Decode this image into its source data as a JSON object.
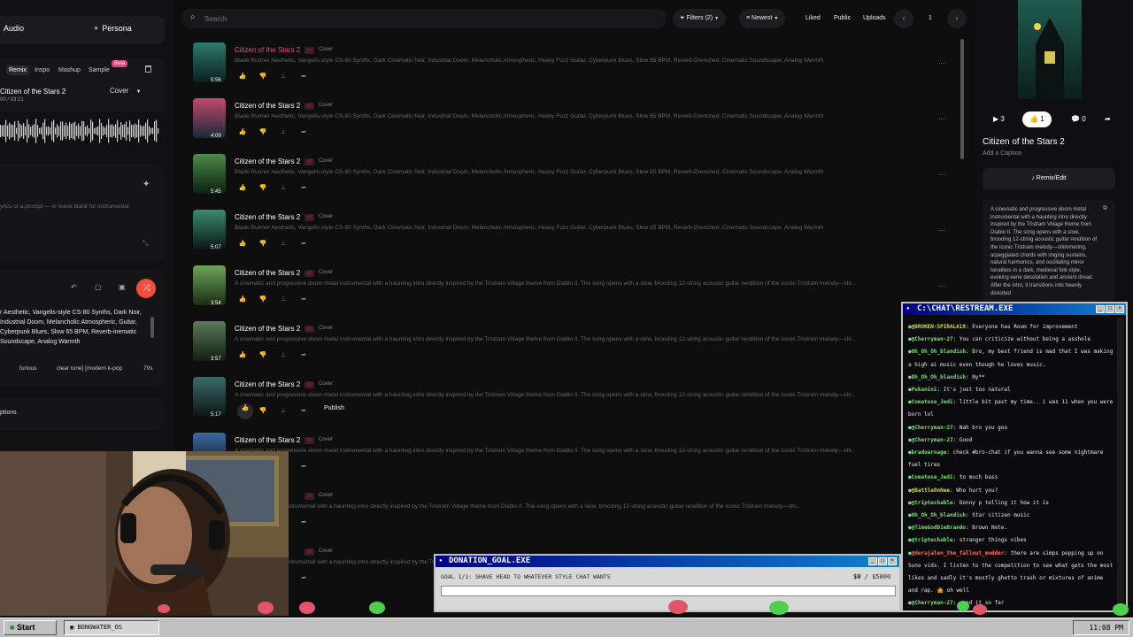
{
  "left": {
    "tab_audio": "Audio",
    "tab_persona": "Persona",
    "modes": [
      "Remix",
      "Inspo",
      "Mashup",
      "Sample"
    ],
    "beta": "Beta",
    "song_title": "Citizen of the Stars 2",
    "song_time": "00 / 03:21",
    "cover_label": "Cover",
    "lyrics_placeholder": "yrics or a prompt — or leave blank for instrumental",
    "style_text": "r Aesthetic, Vangelis-style CS-80 Synths, Dark Noir, Industrial Doom, Melancholic Atmospheric, Guitar, Cyberpunk Blues, Slow 65 BPM, Reverb-inematic Soundscape, Analog Warmth",
    "tags": [
      "furious",
      "clear tone] [modern k-pop",
      "70s"
    ],
    "options_label": "ptions"
  },
  "topbar": {
    "search_placeholder": "Search",
    "filters": "Filters (2)",
    "sort": "Newest",
    "liked": "Liked",
    "public": "Public",
    "uploads": "Uploads",
    "page": "1"
  },
  "songs": [
    {
      "title": "Citizen of the Stars 2",
      "duration": "5:56",
      "cover": "Cover",
      "desc": "Blade Runner Aesthetic, Vangelis-style CS-80 Synths, Dark Cinematic Noir, Industrial Doom, Melancholic Atmospheric, Heavy Fuzz Guitar, Cyberpunk Blues, Slow 65 BPM, Reverb-Drenched, Cinematic Soundscape, Analog Warmth"
    },
    {
      "title": "Citizen of the Stars 2",
      "duration": "4:09",
      "cover": "Cover",
      "desc": "Blade Runner Aesthetic, Vangelis-style CS-80 Synths, Dark Cinematic Noir, Industrial Doom, Melancholic Atmospheric, Heavy Fuzz Guitar, Cyberpunk Blues, Slow 65 BPM, Reverb-Drenched, Cinematic Soundscape, Analog Warmth"
    },
    {
      "title": "Citizen of the Stars 2",
      "duration": "5:45",
      "cover": "Cover",
      "desc": "Blade Runner Aesthetic, Vangelis-style CS-80 Synths, Dark Cinematic Noir, Industrial Doom, Melancholic Atmospheric, Heavy Fuzz Guitar, Cyberpunk Blues, Slow 65 BPM, Reverb-Drenched, Cinematic Soundscape, Analog Warmth"
    },
    {
      "title": "Citizen of the Stars 2",
      "duration": "5:07",
      "cover": "Cover",
      "desc": "Blade Runner Aesthetic, Vangelis-style CS-80 Synths, Dark Cinematic Noir, Industrial Doom, Melancholic Atmospheric, Heavy Fuzz Guitar, Cyberpunk Blues, Slow 65 BPM, Reverb-Drenched, Cinematic Soundscape, Analog Warmth"
    },
    {
      "title": "Citizen of the Stars 2",
      "duration": "3:54",
      "cover": "Cover",
      "desc": "A cinematic and progressive doom metal instrumental with a haunting intro directly inspired by the Tristram Village theme from Diablo II. The song opens with a slow, brooding 12-string acoustic guitar rendition of the iconic Tristram melody—shi..."
    },
    {
      "title": "Citizen of the Stars 2",
      "duration": "3:57",
      "cover": "Cover",
      "desc": "A cinematic and progressive doom metal instrumental with a haunting intro directly inspired by the Tristram Village theme from Diablo II. The song opens with a slow, brooding 12-string acoustic guitar rendition of the iconic Tristram melody—shi..."
    },
    {
      "title": "Citizen of the Stars 2",
      "duration": "5:17",
      "cover": "Cover",
      "desc": "A cinematic and progressive doom metal instrumental with a haunting intro directly inspired by the Tristram Village theme from Diablo II. The song opens with a slow, brooding 12-string acoustic guitar rendition of the iconic Tristram melody—shi...",
      "publish": "Publish"
    },
    {
      "title": "Citizen of the Stars 2",
      "duration": "",
      "cover": "Cover",
      "desc": "A cinematic and progressive doom metal instrumental with a haunting intro directly inspired by the Tristram Village theme from Diablo II. The song opens with a slow, brooding 12-string acoustic guitar rendition of the iconic Tristram melody—shi..."
    },
    {
      "title": "s 2",
      "duration": "",
      "cover": "Cover",
      "desc": "essive doom metal instrumental with a haunting intro directly inspired by the Tristram Village theme from Diablo II. The song opens with a slow, brooding 12-string acoustic guitar rendition of the iconic Tristram melody—shi..."
    },
    {
      "title": "s 2",
      "duration": "",
      "cover": "Cover",
      "desc": "essive doom metal instrumental with a haunting intro directly inspired by the Tristram Village theme from Diablo II. The song opens with a slow, brooding 12-string acoustic guitar rendition of the iconic Tristram melody—shi..."
    }
  ],
  "right": {
    "plays": "3",
    "likes": "1",
    "comments": "0",
    "title": "Citizen of the Stars 2",
    "caption": "Add a Caption",
    "remix": "Remix/Edit",
    "description": "A cinematic and progressive doom metal instrumental with a haunting intro directly inspired by the Tristram Village theme from Diablo II. The song opens with a slow, brooding 12-string acoustic guitar rendition of the iconic Tristram melody—shimmering, arpeggiated chords with ringing sustains, natural harmonics, and oscillating minor tonalities in a dark, medieval folk style, evoking eerie desolation and ancient dread. After the intro, it transitions into heavily distorted"
  },
  "chat": {
    "title": "C:\\CHAT\\RESTREAM.EXE",
    "messages": [
      {
        "user": "@BROKEN-SPIRAL619",
        "text": "Everyone has Room for improvement",
        "c": "y"
      },
      {
        "user": "@Cherryman-27",
        "text": "You can criticize without being a asshole",
        "c": "g"
      },
      {
        "user": "Oh_Oh_Oh_blandish",
        "text": "Bro, my best friend is mad that I was making a high ai music even though he loves music.",
        "c": "g"
      },
      {
        "user": "Oh_Oh_Oh_blandish",
        "text": "Ny**",
        "c": "g"
      },
      {
        "user": "Pukanini",
        "text": "It's just too natural",
        "c": "g"
      },
      {
        "user": "Comatose_Jedi",
        "text": "little bit past my time.. i was 11 when you were born lol",
        "c": "g"
      },
      {
        "user": "@Cherryman-27",
        "text": "Nah bro you goo",
        "c": "g"
      },
      {
        "user": "@Cherryman-27",
        "text": "Good",
        "c": "g"
      },
      {
        "user": "bradoarnage",
        "text": "check #bro-chat if you wanna see some nightmare fuel tires",
        "c": "g"
      },
      {
        "user": "Comatose_Jedi",
        "text": "to much bass",
        "c": "g"
      },
      {
        "user": "@BattleOnNee",
        "text": "Who hurt you?",
        "c": "y"
      },
      {
        "user": "@triptechable",
        "text": "Donny p telling it how it is",
        "c": "g"
      },
      {
        "user": "Oh_Oh_Oh_blandish",
        "text": "Star citizen music",
        "c": "g"
      },
      {
        "user": "@TimeGodDieBrando",
        "text": "Brown Note.",
        "c": "g"
      },
      {
        "user": "@triptechable",
        "text": "stranger things vibes",
        "c": "g"
      },
      {
        "user": "@derajalen_the_fallout_modder",
        "text": "there are simps popping up on Suno vids. I listen to the competition to see what gets the most likes and sadly it's mostly ghetto trash or mixtures of anime and rap. 🤷 oh well",
        "c": "r"
      },
      {
        "user": "@Cherryman-27",
        "text": "good it so far",
        "c": "g"
      }
    ]
  },
  "donation": {
    "title": "DONATION_GOAL.EXE",
    "goal": "GOAL 1/1: SHAVE HEAD TO WHATEVER STYLE CHAT WANTS",
    "current": "$0",
    "target": "/ $5000"
  },
  "taskbar": {
    "start": "Start",
    "item": "BONGWATER_OS",
    "time": "11:08 PM"
  },
  "colors": {
    "accent_pink": "#e44a8c",
    "record_red": "#f04d3f",
    "chat_user_green": "#7be07b"
  }
}
